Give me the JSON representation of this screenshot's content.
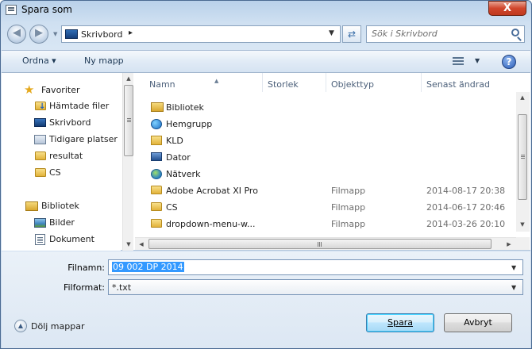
{
  "window": {
    "title": "Spara som",
    "close_label": "X"
  },
  "navigation": {
    "back_glyph": "◀",
    "forward_glyph": "▶",
    "history_glyph": "▼",
    "address": {
      "location": "Skrivbord",
      "separator": "▸",
      "dropdown_glyph": "▼"
    },
    "refresh_glyph": "⇄",
    "search_placeholder": "Sök i Skrivbord"
  },
  "toolbar": {
    "organize_label": "Ordna ▾",
    "new_folder_label": "Ny mapp",
    "view_caret": "▼",
    "help_label": "?"
  },
  "nav_pane": {
    "favorites_label": "Favoriter",
    "favorites": [
      {
        "label": "Hämtade filer",
        "icon": "downloads-icon"
      },
      {
        "label": "Skrivbord",
        "icon": "desktop-icon"
      },
      {
        "label": "Tidigare platser",
        "icon": "recent-places-icon"
      },
      {
        "label": "resultat",
        "icon": "folder-icon"
      },
      {
        "label": "CS",
        "icon": "folder-icon"
      }
    ],
    "libraries_label": "Bibliotek",
    "libraries": [
      {
        "label": "Bilder",
        "icon": "pictures-icon"
      },
      {
        "label": "Dokument",
        "icon": "documents-icon"
      }
    ]
  },
  "file_list": {
    "columns": [
      "Namn",
      "Storlek",
      "Objekttyp",
      "Senast ändrad"
    ],
    "rows": [
      {
        "name": "Bibliotek",
        "type": "",
        "modified": "",
        "icon": "library-icon"
      },
      {
        "name": "Hemgrupp",
        "type": "",
        "modified": "",
        "icon": "homegroup-icon"
      },
      {
        "name": "KLD",
        "type": "",
        "modified": "",
        "icon": "folder-icon"
      },
      {
        "name": "Dator",
        "type": "",
        "modified": "",
        "icon": "computer-icon"
      },
      {
        "name": "Nätverk",
        "type": "",
        "modified": "",
        "icon": "network-icon"
      },
      {
        "name": "Adobe Acrobat XI Pro",
        "type": "Filmapp",
        "modified": "2014-08-17 20:38",
        "icon": "folder-icon"
      },
      {
        "name": "CS",
        "type": "Filmapp",
        "modified": "2014-06-17 20:46",
        "icon": "folder-icon"
      },
      {
        "name": "dropdown-menu-w...",
        "type": "Filmapp",
        "modified": "2014-03-26 20:10",
        "icon": "folder-icon"
      }
    ]
  },
  "form": {
    "filename_label": "Filnamn:",
    "filename_value": "09 002 DP 2014",
    "fileformat_label": "Filformat:",
    "fileformat_value": "*.txt",
    "dropdown_glyph": "▼",
    "hide_folders_label": "Dölj mappar",
    "hide_folders_glyph": "▲",
    "save_label": "Spara",
    "cancel_label": "Avbryt"
  },
  "colors": {
    "selection": "#3399ff",
    "accent": "#3c7fb1",
    "close": "#d0462c"
  }
}
